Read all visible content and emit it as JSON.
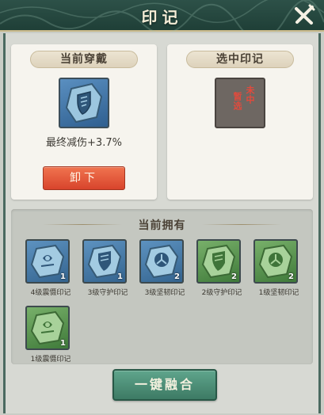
{
  "header": {
    "title": "印记"
  },
  "worn": {
    "tag": "当前穿戴",
    "stat": "最终减伤+3.7%",
    "unequip_label": "卸下"
  },
  "selected": {
    "tag": "选中印记",
    "empty_line1": "未中",
    "empty_line2": "暂选"
  },
  "owned": {
    "title": "当前拥有",
    "items": [
      {
        "label": "4级震慑印记",
        "count": "1",
        "color": "blue",
        "icon": "rune-bolt-icon"
      },
      {
        "label": "3级守护印记",
        "count": "1",
        "color": "blue",
        "icon": "rune-shield-icon"
      },
      {
        "label": "3级坚韧印记",
        "count": "2",
        "color": "blue",
        "icon": "rune-tri-icon"
      },
      {
        "label": "2级守护印记",
        "count": "2",
        "color": "green",
        "icon": "rune-shield-icon"
      },
      {
        "label": "1级坚韧印记",
        "count": "2",
        "color": "green",
        "icon": "rune-tri-icon"
      },
      {
        "label": "1级震慑印记",
        "count": "1",
        "color": "green",
        "icon": "rune-bolt-icon"
      }
    ]
  },
  "merge_label": "一键融合",
  "colors": {
    "header": "#1f3f37",
    "unequip": "#e25a3a",
    "merge": "#4c8e76",
    "rune_blue": "#4a7fad",
    "rune_green": "#5a9a4e"
  }
}
